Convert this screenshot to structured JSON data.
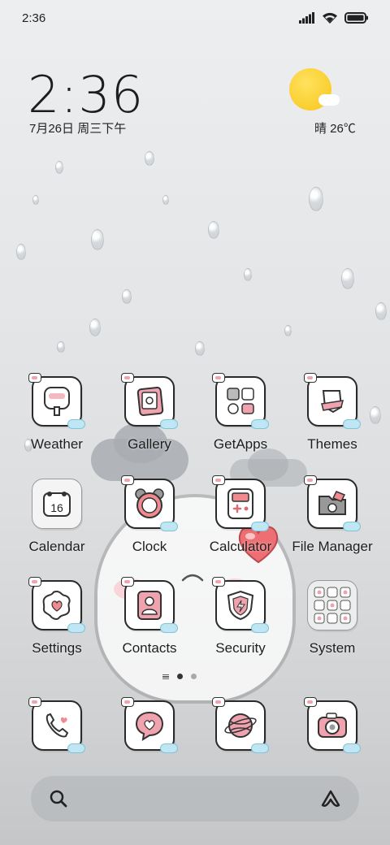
{
  "status_bar": {
    "time": "2:36",
    "icons": [
      "signal-icon",
      "wifi-icon",
      "battery-icon"
    ]
  },
  "clock_widget": {
    "time": "2:36",
    "date": "7月26日 周三下午"
  },
  "weather_widget": {
    "icon": "sun-cloud-icon",
    "text": "晴 26℃"
  },
  "apps": [
    {
      "label": "Weather",
      "icon": "weather-icon"
    },
    {
      "label": "Gallery",
      "icon": "gallery-icon"
    },
    {
      "label": "GetApps",
      "icon": "getapps-icon"
    },
    {
      "label": "Themes",
      "icon": "themes-icon"
    },
    {
      "label": "Calendar",
      "icon": "calendar-icon",
      "value": "16"
    },
    {
      "label": "Clock",
      "icon": "clock-icon"
    },
    {
      "label": "Calculator",
      "icon": "calculator-icon"
    },
    {
      "label": "File Manager",
      "icon": "file-manager-icon"
    },
    {
      "label": "Settings",
      "icon": "settings-icon"
    },
    {
      "label": "Contacts",
      "icon": "contacts-icon"
    },
    {
      "label": "Security",
      "icon": "security-icon"
    },
    {
      "label": "System",
      "icon": "folder-icon"
    }
  ],
  "dock": [
    {
      "icon": "phone-icon"
    },
    {
      "icon": "messages-icon"
    },
    {
      "icon": "browser-icon"
    },
    {
      "icon": "camera-icon"
    }
  ],
  "page_indicator": {
    "pages": 2,
    "active": 1
  },
  "search_bar": {
    "left_icon": "search-icon",
    "right_icon": "assistant-icon"
  },
  "colors": {
    "accent_pink": "#f0a3ae",
    "sun": "#f7c51a",
    "badge_blue": "#bfe6f2"
  }
}
